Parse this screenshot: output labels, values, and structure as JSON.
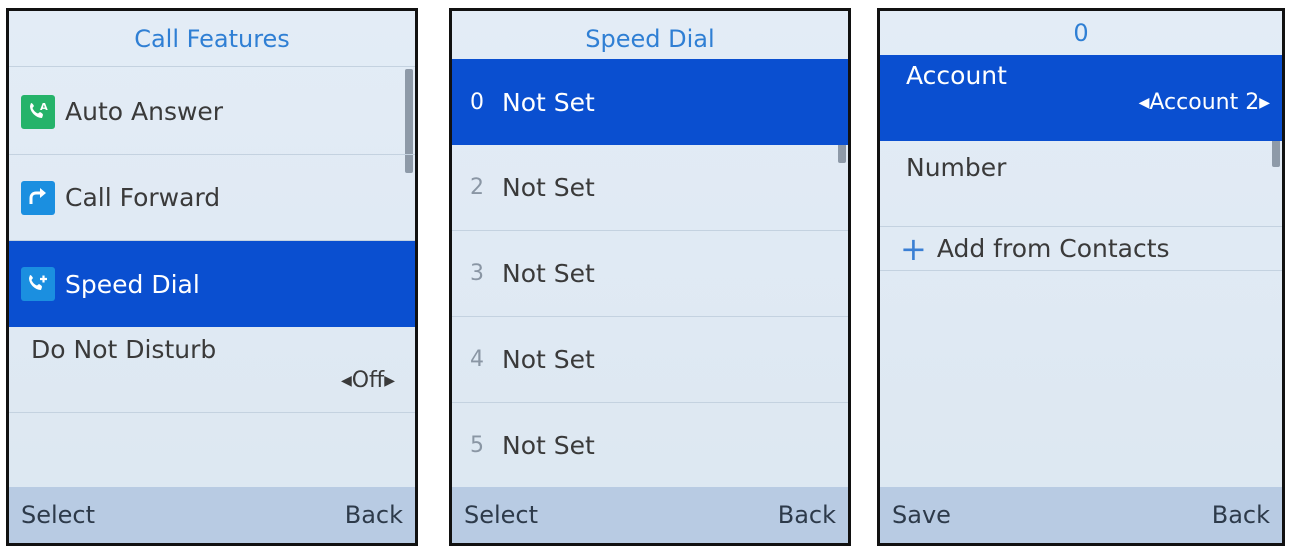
{
  "screen1": {
    "title": "Call Features",
    "items": [
      {
        "label": "Auto Answer",
        "icon": "auto-answer-icon"
      },
      {
        "label": "Call Forward",
        "icon": "call-forward-icon"
      },
      {
        "label": "Speed Dial",
        "icon": "speed-dial-icon",
        "selected": true
      },
      {
        "label": "Do Not Disturb",
        "value": "Off"
      }
    ],
    "softkeys": {
      "left": "Select",
      "right": "Back"
    }
  },
  "screen2": {
    "title": "Speed Dial",
    "items": [
      {
        "num": "0",
        "label": "Not Set",
        "selected": true
      },
      {
        "num": "2",
        "label": "Not Set"
      },
      {
        "num": "3",
        "label": "Not Set"
      },
      {
        "num": "4",
        "label": "Not Set"
      },
      {
        "num": "5",
        "label": "Not Set"
      }
    ],
    "softkeys": {
      "left": "Select",
      "right": "Back"
    }
  },
  "screen3": {
    "title": "0",
    "account": {
      "label": "Account",
      "value": "Account 2"
    },
    "number": {
      "label": "Number"
    },
    "add_contacts": {
      "label": "Add from Contacts"
    },
    "softkeys": {
      "left": "Save",
      "right": "Back"
    }
  },
  "colors": {
    "selected": "#0a4fd0",
    "title": "#2f7fd4",
    "softkey_bar": "#b8cbe3"
  }
}
